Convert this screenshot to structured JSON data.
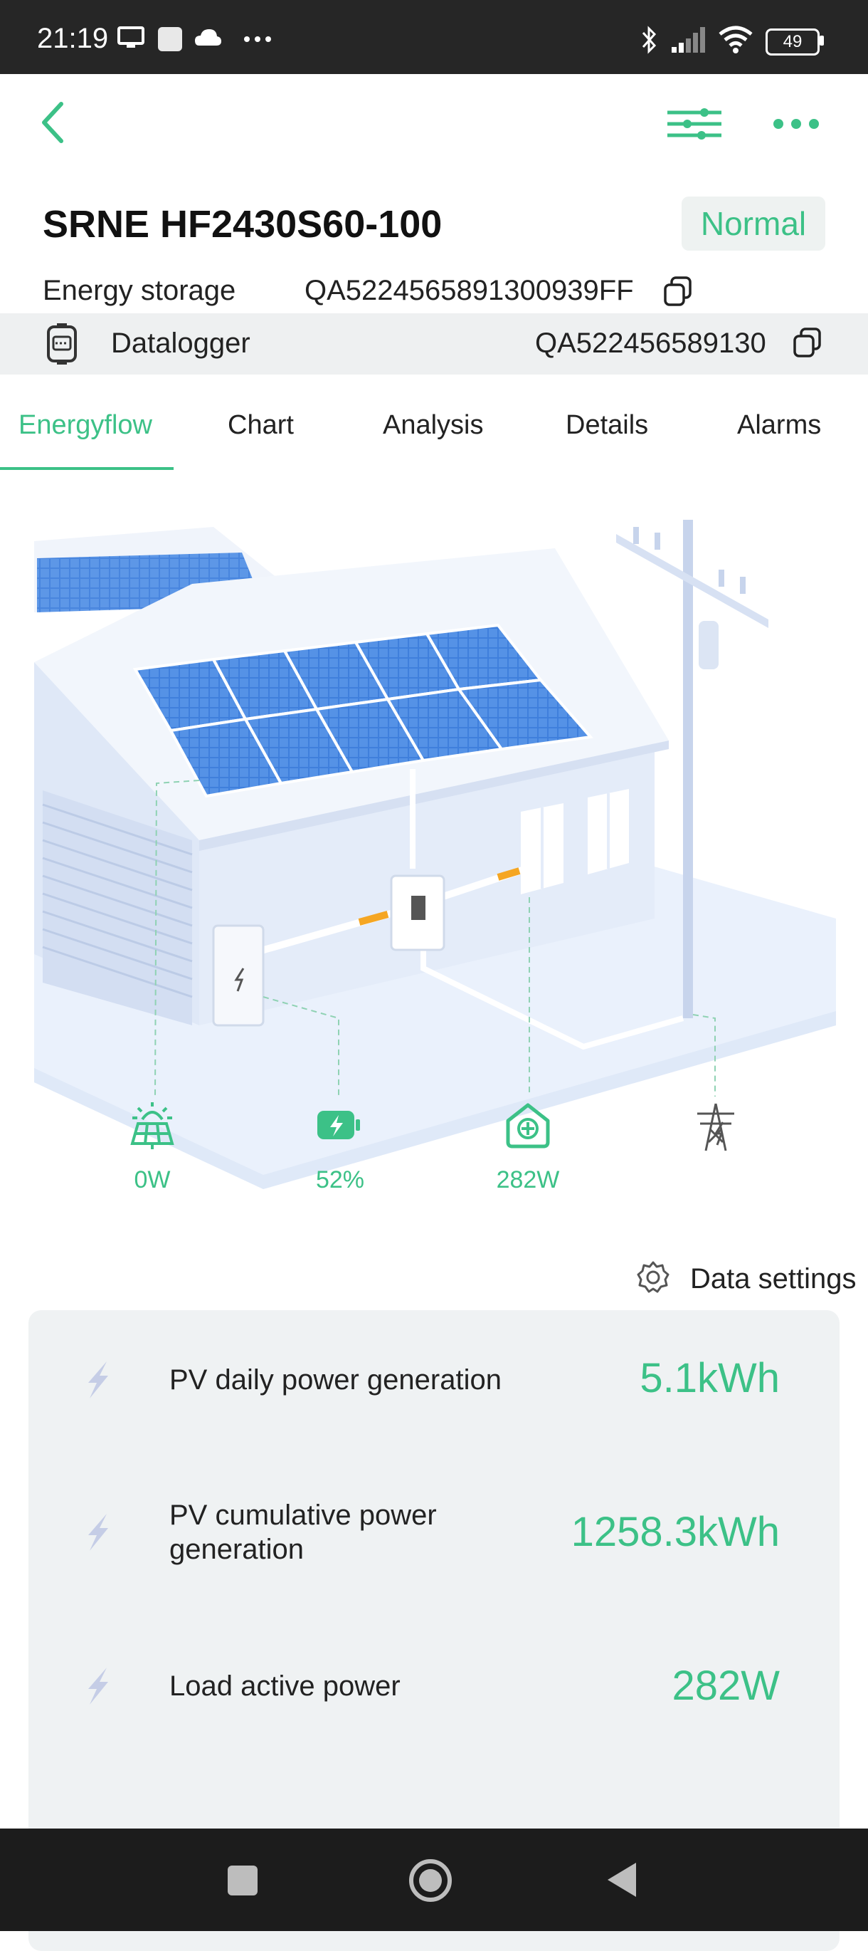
{
  "status_bar": {
    "time": "21:19",
    "battery": "49"
  },
  "header": {
    "device_name": "SRNE HF2430S60-100",
    "status_badge": "Normal",
    "device_type": "Energy storage",
    "device_serial": "QA5224565891300939FF",
    "datalogger_label": "Datalogger",
    "datalogger_serial": "QA522456589130"
  },
  "tabs": [
    {
      "label": "Energyflow",
      "active": true
    },
    {
      "label": "Chart",
      "active": false
    },
    {
      "label": "Analysis",
      "active": false
    },
    {
      "label": "Details",
      "active": false
    },
    {
      "label": "Alarms",
      "active": false
    }
  ],
  "energyflow": {
    "pv_power": "0W",
    "battery_soc": "52%",
    "load_power": "282W",
    "icons": [
      "solar-panel-icon",
      "battery-charging-icon",
      "home-load-icon",
      "grid-tower-icon"
    ]
  },
  "data_settings_label": "Data settings",
  "metrics": [
    {
      "label": "PV daily power generation",
      "value": "5.1kWh"
    },
    {
      "label": "PV cumulative power generation",
      "value": "1258.3kWh"
    },
    {
      "label": "Load active power",
      "value": "282W"
    }
  ],
  "colors": {
    "accent": "#3cc187",
    "card_bg": "#eff2f3",
    "status_bar": "#262626"
  }
}
